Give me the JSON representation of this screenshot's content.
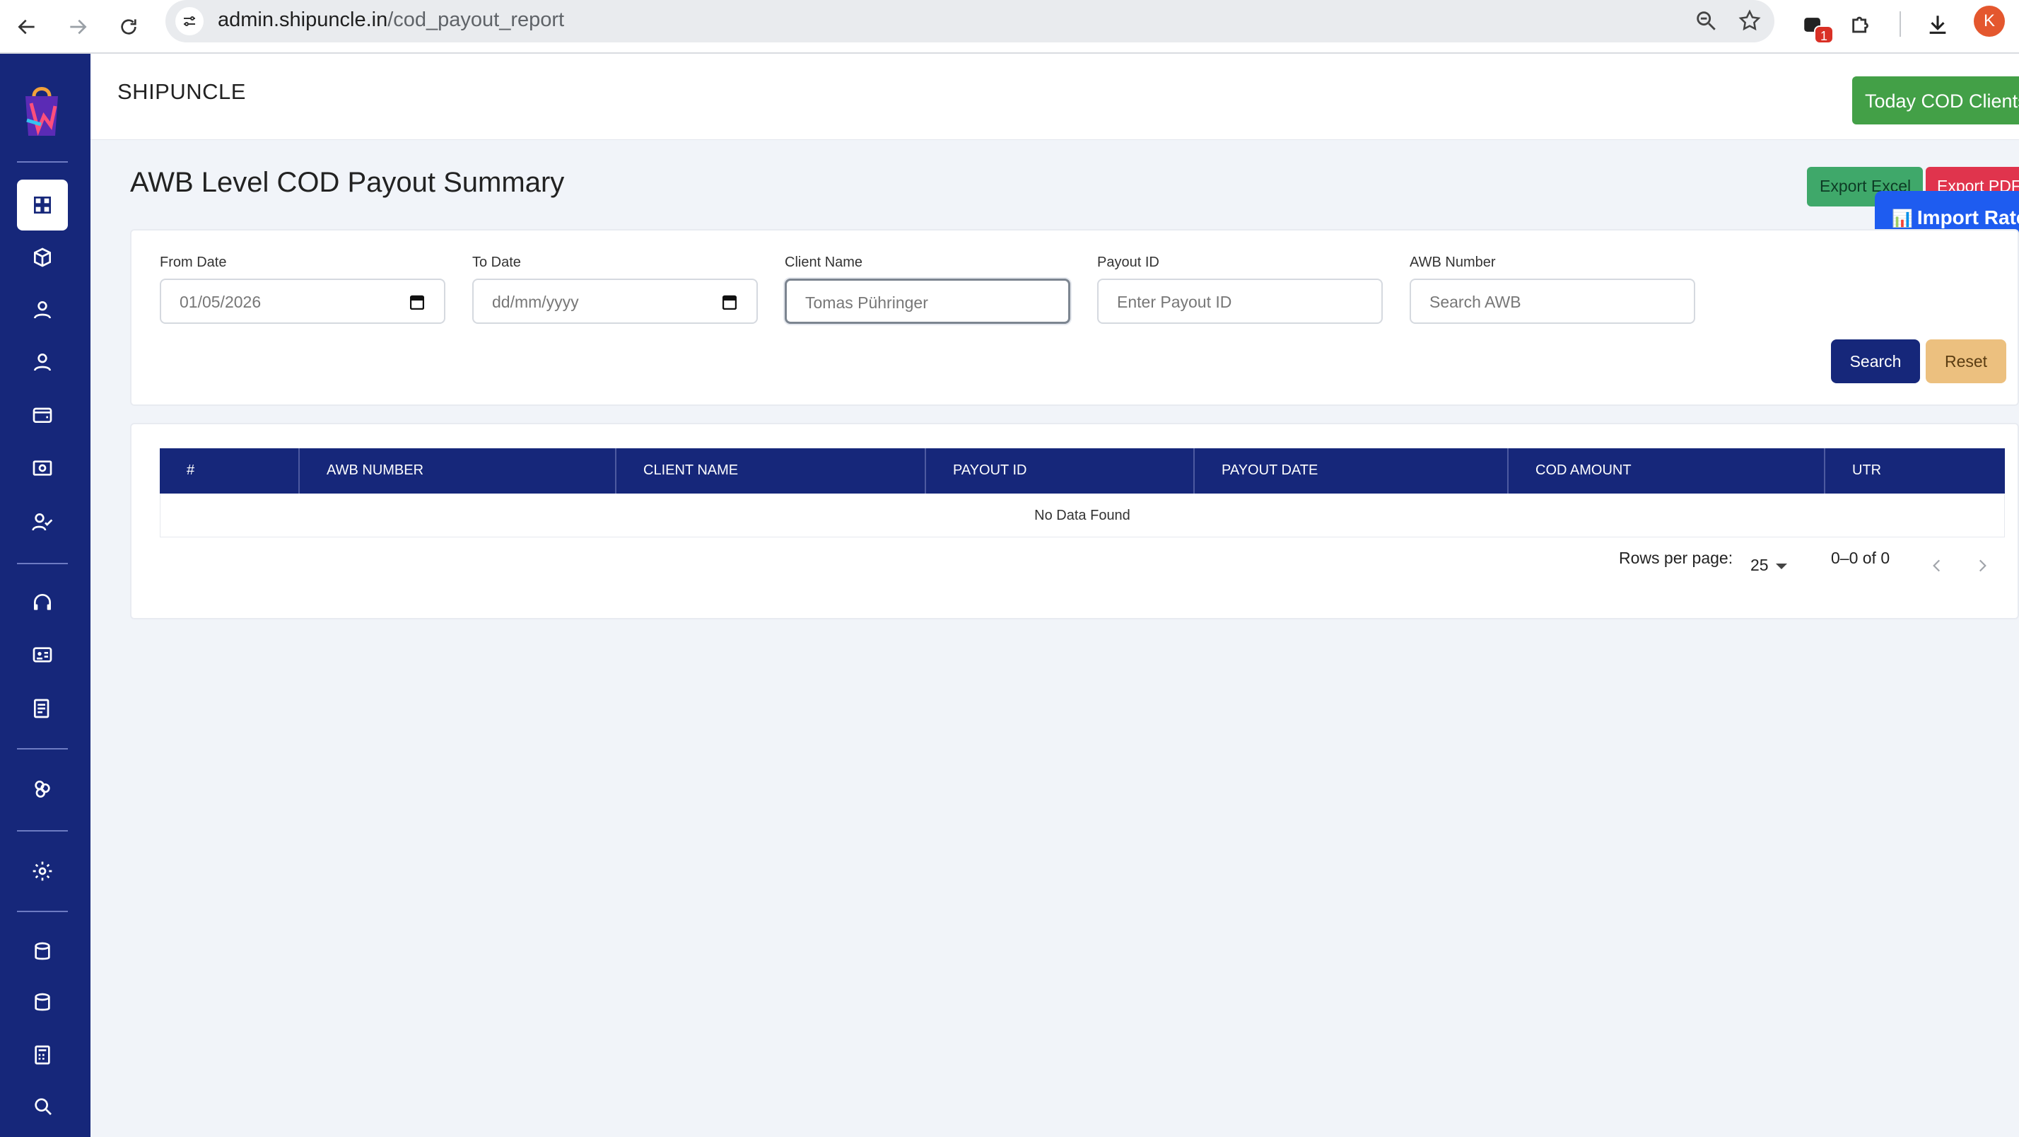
{
  "browser": {
    "url_host": "admin.shipuncle.in",
    "url_path": "/cod_payout_report",
    "extension_badge": "1",
    "profile_initial": "K"
  },
  "sidebar": {
    "items": [
      {
        "icon": "dashboard-icon",
        "active": true
      },
      {
        "icon": "box-icon"
      },
      {
        "icon": "user-icon"
      },
      {
        "icon": "user-icon"
      },
      {
        "icon": "wallet-icon"
      },
      {
        "icon": "cash-icon"
      },
      {
        "icon": "user-check-icon"
      },
      {
        "icon": "headset-icon"
      },
      {
        "icon": "id-card-icon"
      },
      {
        "icon": "report-icon"
      },
      {
        "icon": "integrations-icon"
      },
      {
        "icon": "gear-icon"
      },
      {
        "icon": "database-icon"
      },
      {
        "icon": "database-icon"
      },
      {
        "icon": "calculator-icon"
      },
      {
        "icon": "search-icon"
      }
    ]
  },
  "header": {
    "brand": "SHIPUNCLE",
    "today_cod_button": "Today COD Clients"
  },
  "page": {
    "title": "AWB Level COD Payout Summary",
    "export_excel": "Export Excel",
    "export_pdf": "Export PDF",
    "import_rate_icon": "📊",
    "import_rate": "Import Rate"
  },
  "filters": {
    "from_date": {
      "label": "From Date",
      "value": "01/05/2026"
    },
    "to_date": {
      "label": "To Date",
      "placeholder": "dd/mm/yyyy"
    },
    "client_name": {
      "label": "Client Name",
      "placeholder": "Tomas Pühringer"
    },
    "payout_id": {
      "label": "Payout ID",
      "placeholder": "Enter Payout ID"
    },
    "awb_number": {
      "label": "AWB Number",
      "placeholder": "Search AWB"
    },
    "search_button": "Search",
    "reset_button": "Reset"
  },
  "table": {
    "columns": [
      "#",
      "AWB NUMBER",
      "CLIENT NAME",
      "PAYOUT ID",
      "PAYOUT DATE",
      "COD AMOUNT",
      "UTR"
    ],
    "empty_message": "No Data Found",
    "rows_per_page_label": "Rows per page:",
    "rows_per_page": "25",
    "range": "0–0 of 0"
  },
  "colors": {
    "sidebar": "#16277a",
    "today_cod": "#43a047",
    "export_excel": "#3fa86a",
    "export_pdf": "#e0344d",
    "import_rate": "#1e5cf0",
    "reset": "#ecc07f"
  }
}
